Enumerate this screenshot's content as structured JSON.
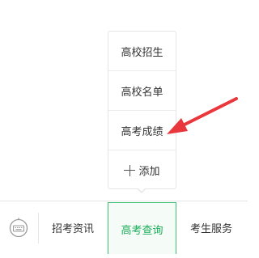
{
  "menu": {
    "tabs": [
      {
        "label": "招考资讯"
      },
      {
        "label": "高考查询"
      },
      {
        "label": "考生服务"
      }
    ]
  },
  "submenu": {
    "items": [
      {
        "label": "高校招生"
      },
      {
        "label": "高校名单"
      },
      {
        "label": "高考成绩"
      }
    ],
    "add_label": "添加"
  },
  "colors": {
    "accent": "#1aad5a",
    "accent_border": "#3fbf73",
    "arrow": "#e8373d"
  },
  "icons": {
    "keyboard_toggle": "keyboard-icon",
    "add": "plus-icon",
    "annotation": "red-arrow-icon"
  }
}
